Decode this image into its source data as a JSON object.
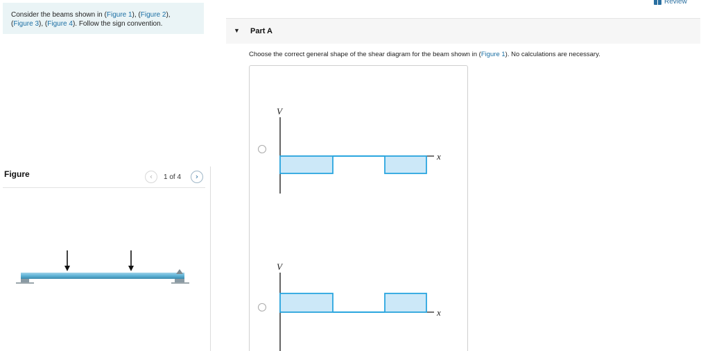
{
  "intro": {
    "text_1": "Consider the beams shown in (",
    "link_fig1": "Figure 1",
    "text_2": "), (",
    "link_fig2": "Figure 2",
    "text_3": "),",
    "text_4": "(",
    "link_fig3": "Figure 3",
    "text_5": "), (",
    "link_fig4": "Figure 4",
    "text_6": "). Follow the sign convention."
  },
  "figure_panel": {
    "title": "Figure",
    "prev_icon": "‹",
    "next_icon": "›",
    "counter": "1 of 4"
  },
  "review": {
    "label": "Review"
  },
  "part": {
    "label": "Part A",
    "caret": "▼"
  },
  "question": {
    "text_1": "Choose the correct general shape of the shear diagram for the beam shown in (",
    "link": "Figure 1",
    "text_2": "). No calculations are necessary."
  },
  "options": [
    {
      "axis_v": "V",
      "axis_x": "x",
      "selected": false
    },
    {
      "axis_v": "V",
      "axis_x": "x",
      "selected": false
    }
  ],
  "colors": {
    "accent_link": "#1a6ea3",
    "diagram_fill": "#cce8f8",
    "diagram_stroke": "#2aa6df",
    "intro_bg": "#eaf4f6"
  }
}
